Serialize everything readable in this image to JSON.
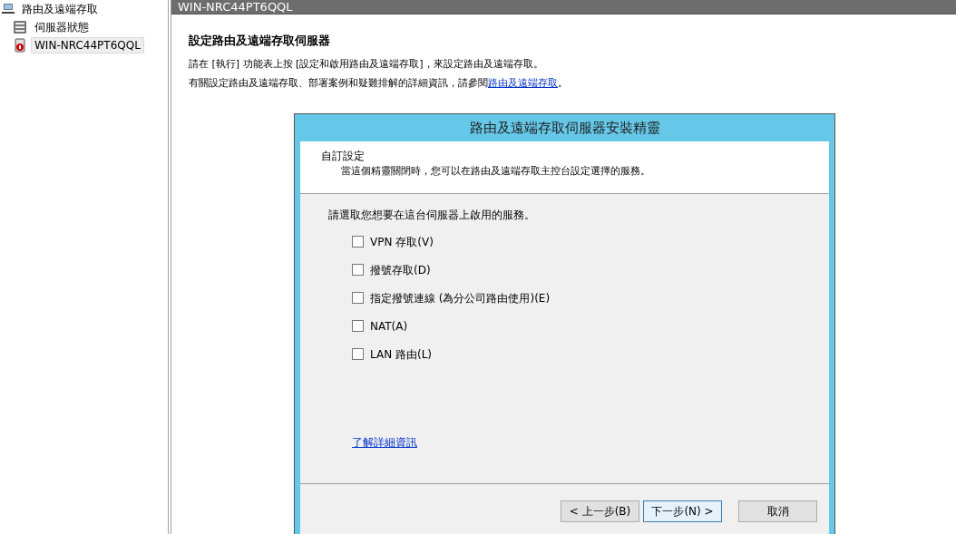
{
  "tree": [
    {
      "label": "路由及遠端存取",
      "selected": false,
      "children": [
        {
          "label": "伺服器狀態",
          "selected": false,
          "kind": "status"
        },
        {
          "label": "WIN-NRC44PT6QQL",
          "selected": true,
          "kind": "server"
        }
      ]
    }
  ],
  "header": {
    "title": "WIN-NRC44PT6QQL"
  },
  "content": {
    "heading": "設定路由及遠端存取伺服器",
    "line_1": "請在 [執行] 功能表上按 [設定和啟用路由及遠端存取]，來設定路由及遠端存取。",
    "line_2": {
      "before": "有關設定路由及遠端存取、部署案例和疑難排解的詳細資訊，請參閱",
      "link": "路由及遠端存取",
      "after": "。"
    }
  },
  "wizard": {
    "title": "路由及遠端存取伺服器安裝精靈",
    "section_title": "自訂設定",
    "section_subtitle": "當這個精靈關閉時，您可以在路由及遠端存取主控台設定選擇的服務。",
    "prompt": "請選取您想要在這台伺服器上啟用的服務。",
    "options": [
      {
        "label": "VPN 存取(V)",
        "checked": false
      },
      {
        "label": "撥號存取(D)",
        "checked": false
      },
      {
        "label": "指定撥號連線 (為分公司路由使用)(E)",
        "checked": false
      },
      {
        "label": "NAT(A)",
        "checked": false
      },
      {
        "label": "LAN 路由(L)",
        "checked": false
      }
    ],
    "more_link": "了解詳細資訊",
    "buttons": [
      {
        "label": "< 上一步(B)",
        "kind": "normal"
      },
      {
        "label": "下一步(N) >",
        "kind": "default"
      },
      {
        "label": "取消",
        "kind": "cancel"
      }
    ]
  }
}
